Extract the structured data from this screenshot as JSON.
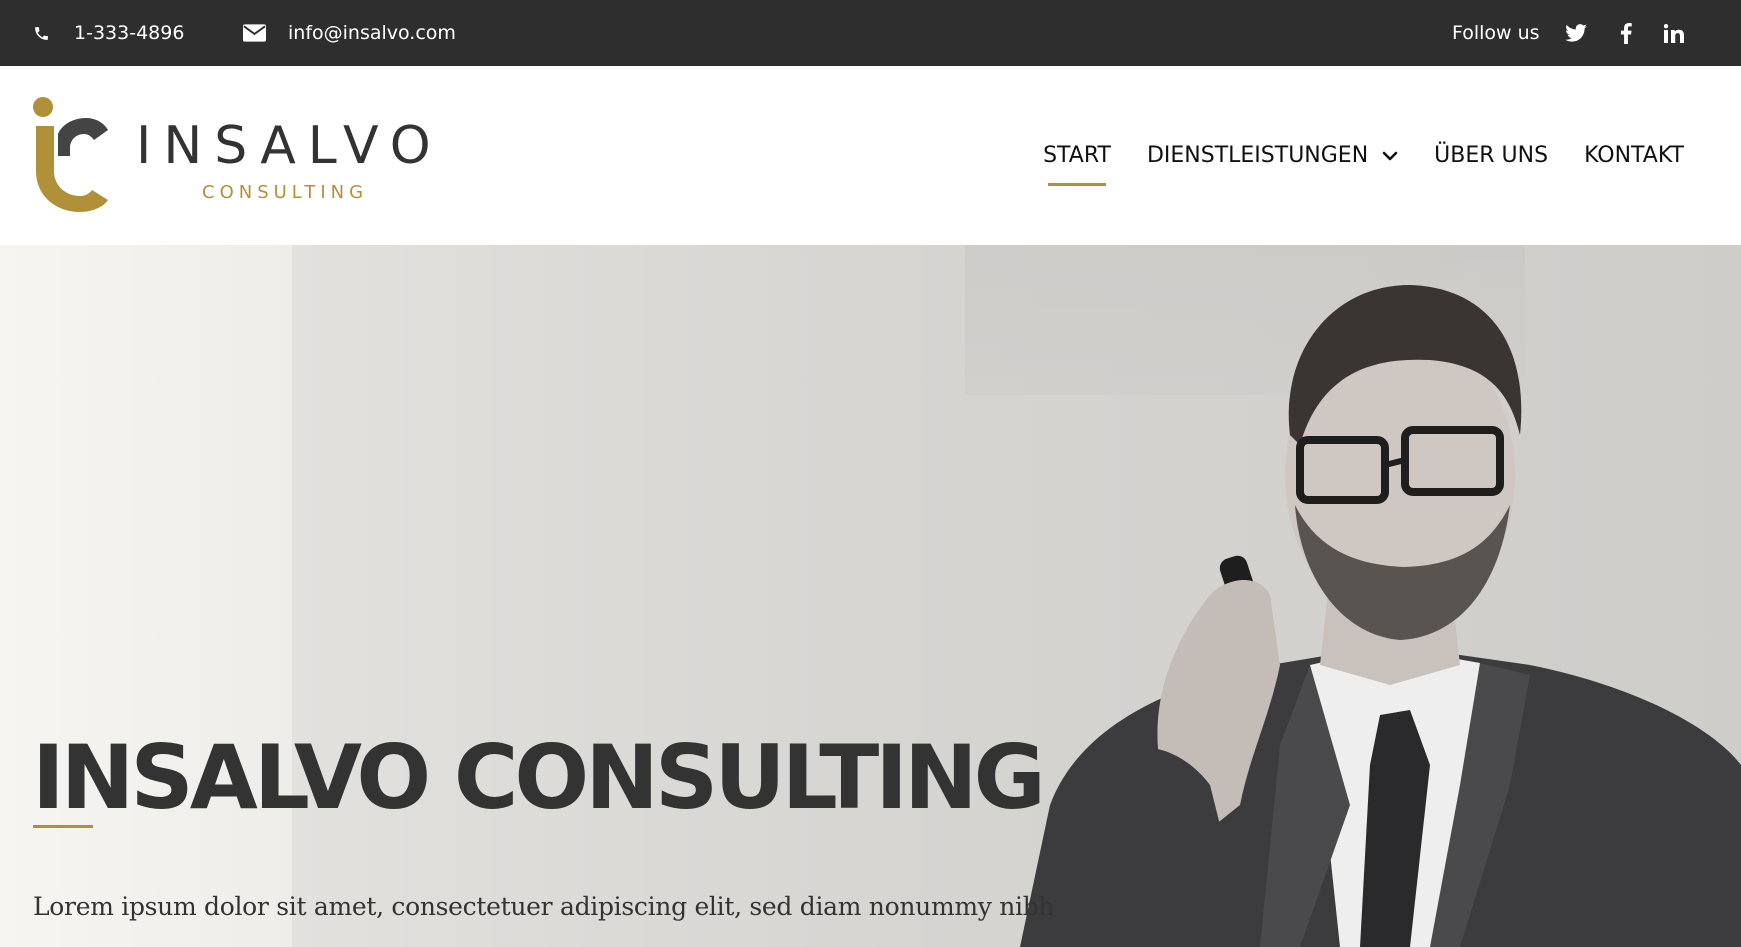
{
  "topbar": {
    "phone": "1-333-4896",
    "email": "info@insalvo.com",
    "follow_label": "Follow us",
    "social": [
      "twitter-icon",
      "facebook-icon",
      "linkedin-icon"
    ],
    "background": "#2e2e2e"
  },
  "header": {
    "logo": {
      "wordmark": "INSALVO",
      "tagline": "CONSULTING"
    },
    "nav": {
      "items": [
        {
          "label": "START",
          "active": true
        },
        {
          "label": "DIENSTLEISTUNGEN",
          "has_dropdown": true
        },
        {
          "label": "ÜBER UNS"
        },
        {
          "label": "KONTAKT"
        }
      ]
    }
  },
  "hero": {
    "title": "INSALVO CONSULTING",
    "text": "Lorem ipsum dolor sit amet, consectetuer adipiscing elit, sed diam nonummy nibh",
    "image": "man-on-phone-photo"
  },
  "colors": {
    "accent": "#b0913a",
    "dark_text": "#333333"
  }
}
